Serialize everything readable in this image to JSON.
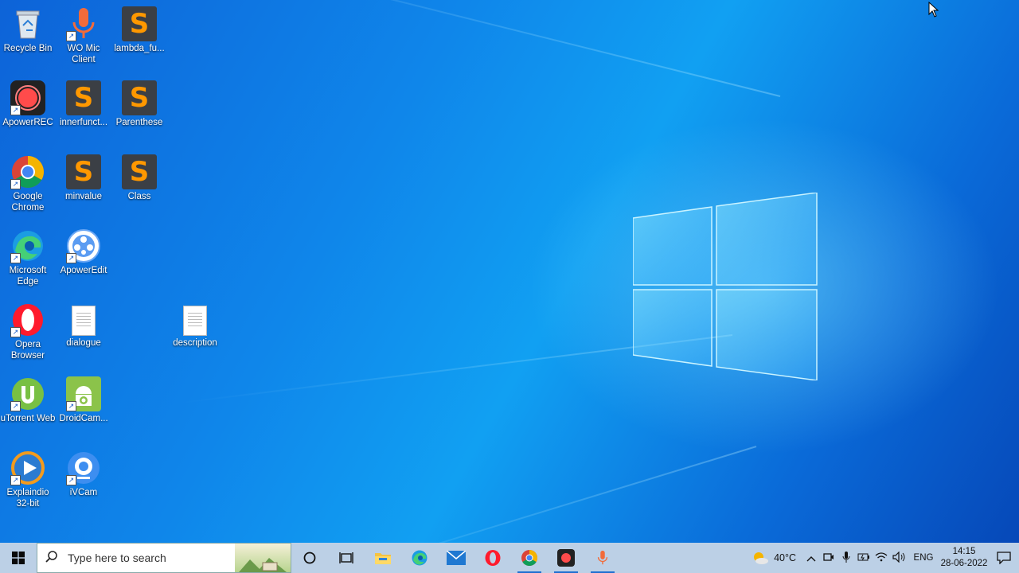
{
  "desktop": {
    "icons": [
      {
        "id": "recycle-bin",
        "label": "Recycle Bin"
      },
      {
        "id": "wo-mic",
        "label": "WO Mic Client"
      },
      {
        "id": "lambda",
        "label": "lambda_fu..."
      },
      {
        "id": "apowerrec",
        "label": "ApowerREC"
      },
      {
        "id": "innerfunct",
        "label": "innerfunct..."
      },
      {
        "id": "parenthese",
        "label": "Parenthese"
      },
      {
        "id": "chrome",
        "label": "Google Chrome"
      },
      {
        "id": "minvalue",
        "label": "minvalue"
      },
      {
        "id": "class",
        "label": "Class"
      },
      {
        "id": "edge",
        "label": "Microsoft Edge"
      },
      {
        "id": "apoweredit",
        "label": "ApowerEdit"
      },
      {
        "id": "opera",
        "label": "Opera Browser"
      },
      {
        "id": "dialogue",
        "label": "dialogue"
      },
      {
        "id": "description",
        "label": "description"
      },
      {
        "id": "utorrent",
        "label": "uTorrent Web"
      },
      {
        "id": "droidcam",
        "label": "DroidCam..."
      },
      {
        "id": "explaindio",
        "label": "Explaindio 32-bit"
      },
      {
        "id": "ivcam",
        "label": "iVCam"
      }
    ]
  },
  "taskbar": {
    "search_placeholder": "Type here to search",
    "weather_temp": "40°C",
    "language": "ENG",
    "time": "14:15",
    "date": "28-06-2022",
    "colors": {
      "accent": "#1f6fd0",
      "taskbar_bg": "#bcd0e6"
    }
  }
}
